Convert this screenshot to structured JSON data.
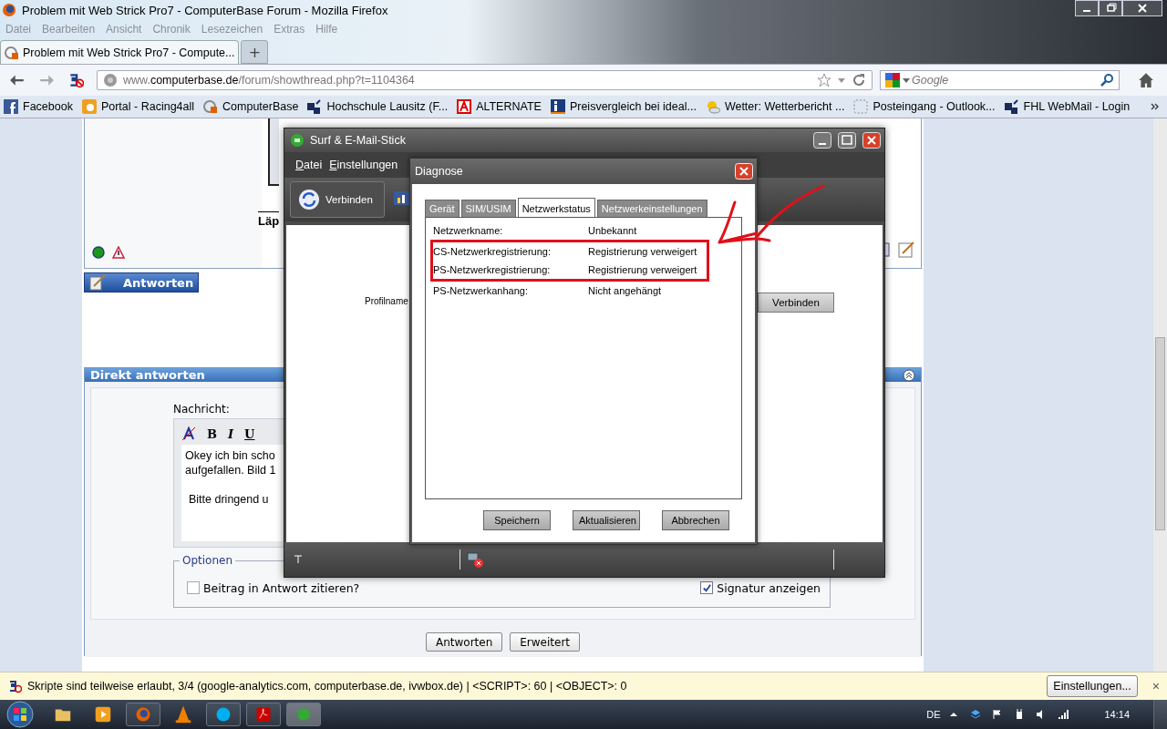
{
  "browser": {
    "title": "Problem mit Web Strick Pro7 - ComputerBase Forum - Mozilla Firefox",
    "menu": [
      "Datei",
      "Bearbeiten",
      "Ansicht",
      "Chronik",
      "Lesezeichen",
      "Extras",
      "Hilfe"
    ],
    "tabs": [
      {
        "label": "Problem mit Web Strick Pro7 - Compute...",
        "selected": true
      }
    ],
    "new_tab": "+",
    "url": {
      "prefix": "www.",
      "domain": "computerbase.de",
      "path": "/forum/showthread.php?t=1104364"
    },
    "search": {
      "placeholder": "Google"
    },
    "bookmarks": [
      {
        "label": "Facebook",
        "kind": "facebook"
      },
      {
        "label": "Portal - Racing4all",
        "kind": "portal"
      },
      {
        "label": "ComputerBase",
        "kind": "cb"
      },
      {
        "label": "Hochschule Lausitz (F...",
        "kind": "squares"
      },
      {
        "label": "ALTERNATE",
        "kind": "alternate"
      },
      {
        "label": "Preisvergleich bei ideal...",
        "kind": "info"
      },
      {
        "label": "Wetter: Wetterbericht ...",
        "kind": "weather"
      },
      {
        "label": "Posteingang - Outlook...",
        "kind": "blank"
      },
      {
        "label": "FHL WebMail - Login",
        "kind": "squares"
      }
    ]
  },
  "forum": {
    "heading_fragment": "Läp",
    "reply_button": "Antworten",
    "quick_reply": {
      "title": "Direkt antworten",
      "message_label": "Nachricht:",
      "format_buttons": [
        "B",
        "I",
        "U"
      ],
      "message_paragraphs": [
        [
          "Okey ich bin scho",
          "aufgefallen. Bild 1"
        ],
        [
          "Bitte dringend u"
        ]
      ],
      "options_legend": "Optionen",
      "options": [
        {
          "label": "Beitrag in Antwort zitieren?",
          "checked": false
        },
        {
          "label": "Signatur anzeigen",
          "checked": true
        }
      ],
      "buttons": [
        "Antworten",
        "Erweitert"
      ]
    }
  },
  "app_window": {
    "title": "Surf & E-Mail-Stick",
    "menu": [
      "Datei",
      "Einstellungen"
    ],
    "toolbar_button": "Verbinden",
    "profile_label": "Profilname",
    "connect_button": "Verbinden"
  },
  "dialog": {
    "title": "Diagnose",
    "tabs": [
      {
        "label": "Gerät",
        "selected": false
      },
      {
        "label": "SIM/USIM",
        "selected": false
      },
      {
        "label": "Netzwerkstatus",
        "selected": true
      },
      {
        "label": "Netzwerkeinstellungen",
        "selected": false
      }
    ],
    "rows": [
      {
        "label": "Netzwerkname:",
        "value": "Unbekannt",
        "highlighted": false
      },
      {
        "label": "CS-Netzwerkregistrierung:",
        "value": "Registrierung verweigert",
        "highlighted": true
      },
      {
        "label": "PS-Netzwerkregistrierung:",
        "value": "Registrierung verweigert",
        "highlighted": true
      },
      {
        "label": "PS-Netzwerkanhang:",
        "value": "Nicht angehängt",
        "highlighted": false
      }
    ],
    "buttons": [
      "Speichern",
      "Aktualisieren",
      "Abbrechen"
    ]
  },
  "notification": {
    "text": "Skripte sind teilweise erlaubt, 3/4 (google-analytics.com, computerbase.de, ivwbox.de) | <SCRIPT>: 60 | <OBJECT>: 0",
    "button": "Einstellungen...",
    "close": "×"
  },
  "taskbar": {
    "language": "DE",
    "time": "14:14"
  }
}
